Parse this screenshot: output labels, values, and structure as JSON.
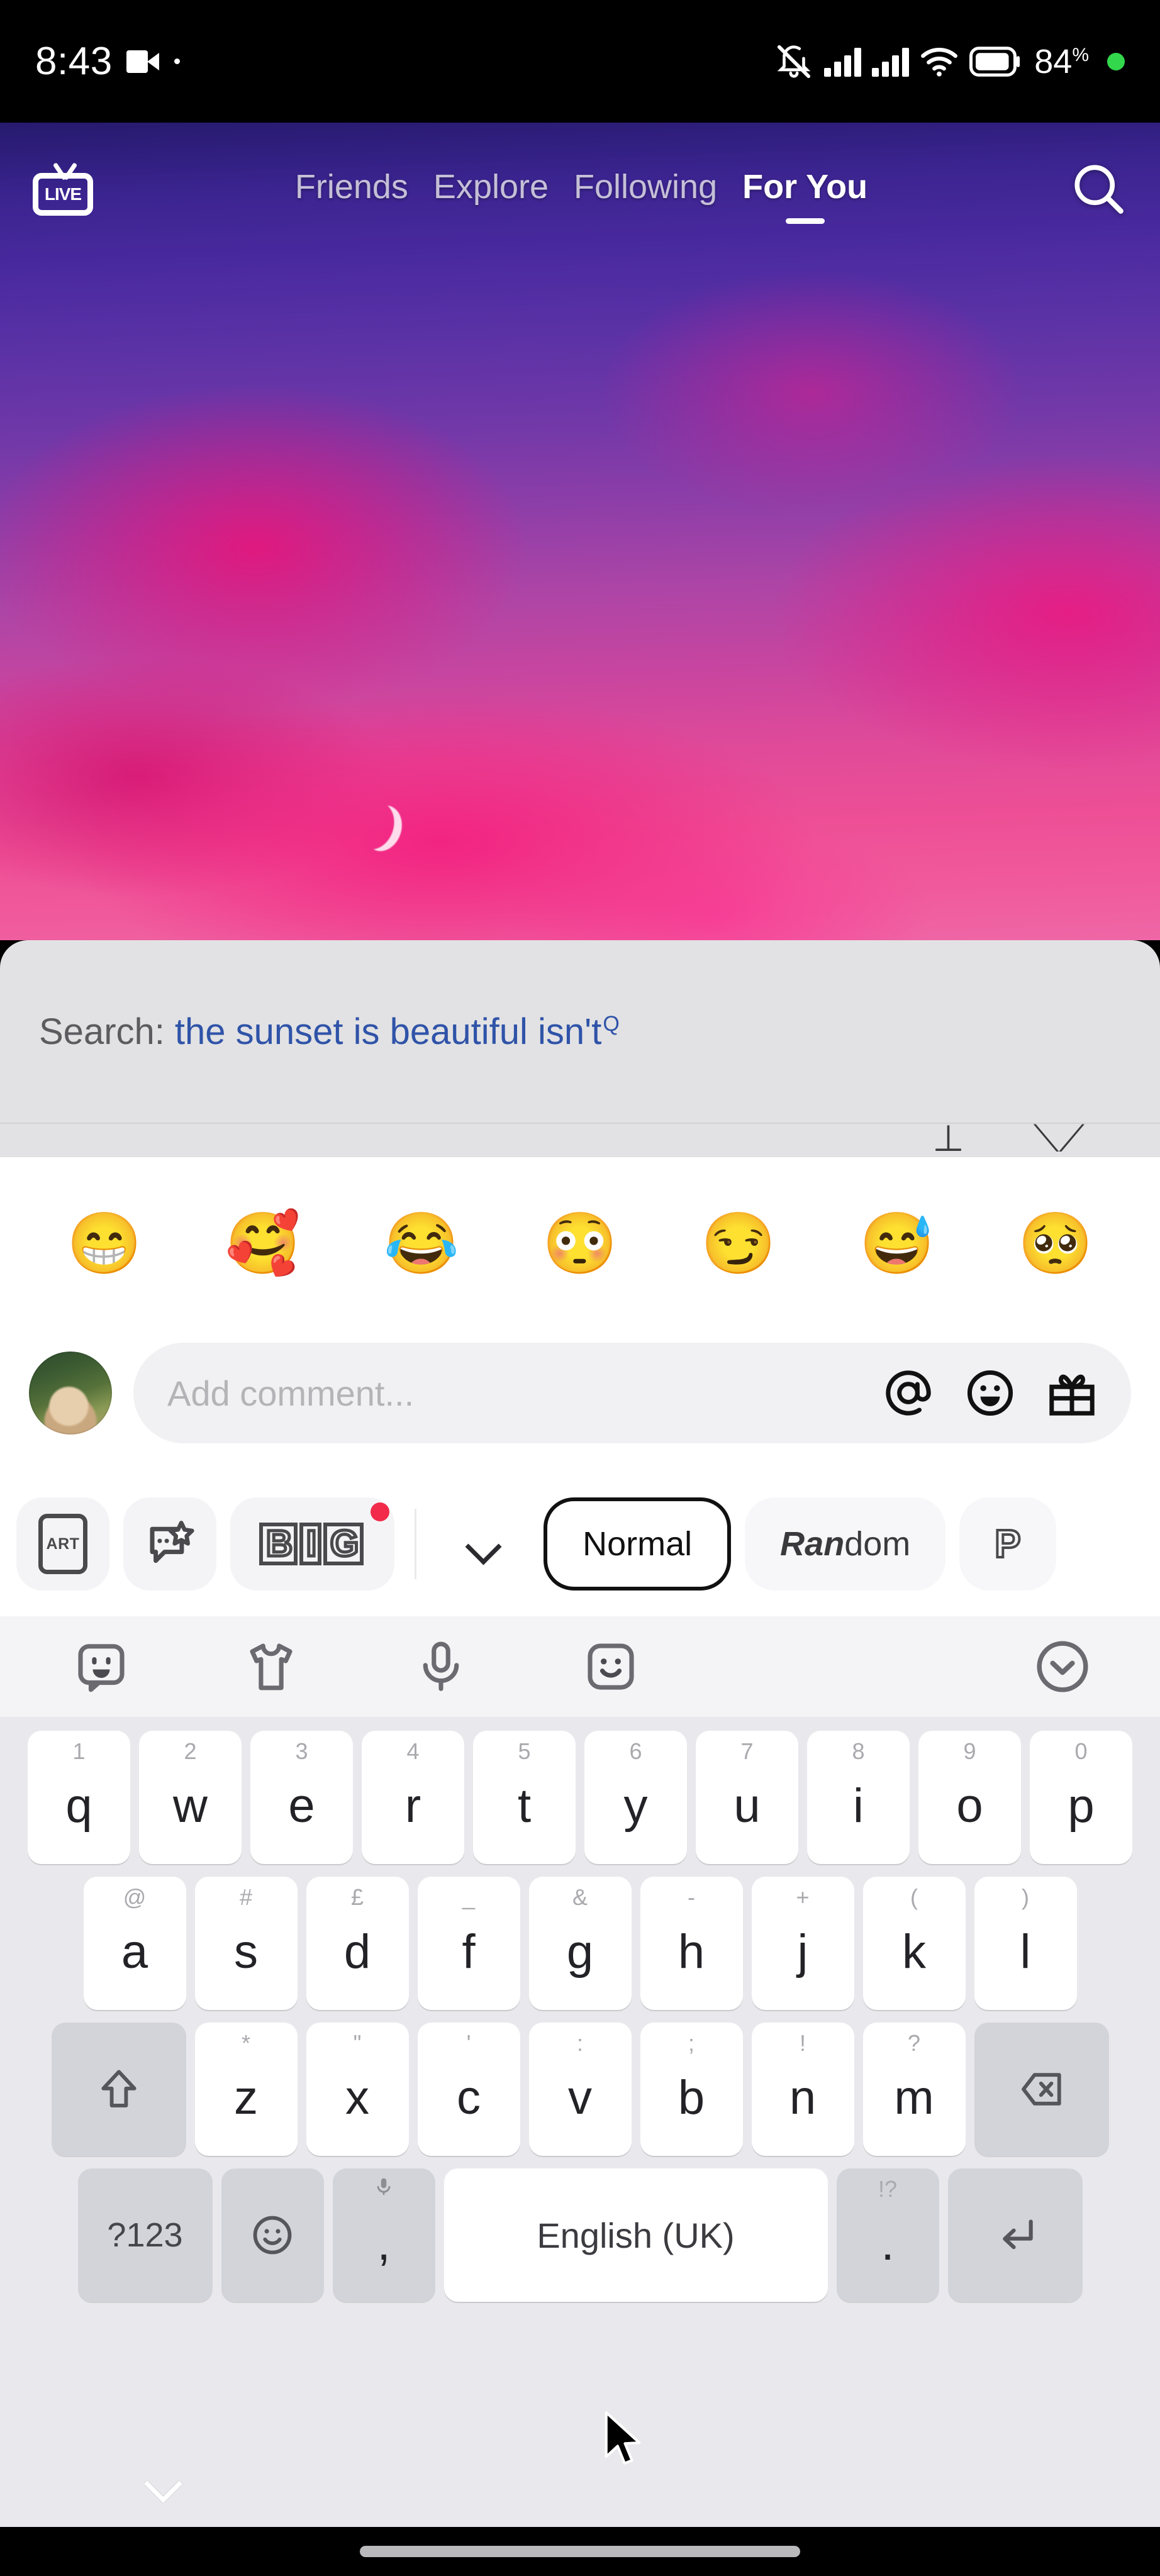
{
  "status_bar": {
    "time": "8:43",
    "video_icon": "video-camera-icon",
    "recording_dot": "·",
    "mute_icon": "bell-muted-icon",
    "signal_1": "signal-bars-icon",
    "signal_2": "signal-bars-icon",
    "wifi_icon": "wifi-icon",
    "battery_icon": "battery-icon",
    "battery_percent": "84",
    "battery_percent_symbol": "%",
    "green_dot": "recording-indicator-dot"
  },
  "top_nav": {
    "live_label": "LIVE",
    "tabs": [
      {
        "label": "Friends",
        "active": false
      },
      {
        "label": "Explore",
        "active": false
      },
      {
        "label": "Following",
        "active": false
      },
      {
        "label": "For You",
        "active": true
      }
    ],
    "search_icon": "search-icon"
  },
  "video": {
    "description": "sunset sky with pink and purple clouds and a crescent moon"
  },
  "suggestion_sheet": {
    "label": "Search:",
    "query": "the sunset is beautiful isn't",
    "query_badge": "Q",
    "second_row_partial": "⊥ᵢ  ⟍⟋"
  },
  "emoji_quick_row": {
    "emojis": [
      {
        "char": "😁",
        "name": "beaming-face-emoji"
      },
      {
        "char": "🥰",
        "name": "smiling-face-with-hearts-emoji"
      },
      {
        "char": "😂",
        "name": "face-with-tears-of-joy-emoji"
      },
      {
        "char": "😳",
        "name": "flushed-face-emoji"
      },
      {
        "char": "😏",
        "name": "smirking-face-emoji"
      },
      {
        "char": "😅",
        "name": "grinning-face-with-sweat-emoji"
      },
      {
        "char": "🥺",
        "name": "pleading-face-emoji"
      }
    ]
  },
  "comment_bar": {
    "avatar": "user-avatar",
    "placeholder": "Add comment...",
    "mention_icon": "at-mention-icon",
    "emoji_icon": "smiley-face-icon",
    "gift_icon": "gift-icon"
  },
  "style_bar": {
    "art_label": "ART",
    "sticker_icon": "sticker-star-icon",
    "big_label": "BIG",
    "big_has_badge": true,
    "badge_color": "#f22b4a",
    "chevron_icon": "chevron-down-icon",
    "options": [
      {
        "label": "Normal",
        "selected": true
      },
      {
        "label_bold": "Ran",
        "label_rest": "dom",
        "selected": false
      },
      {
        "label": "P",
        "selected": false
      }
    ]
  },
  "keyboard": {
    "toolbar_icons": [
      "emoji-sticker-icon",
      "tshirt-icon",
      "microphone-icon",
      "smiley-sticker-icon"
    ],
    "collapse_icon": "chevron-down-circle-icon",
    "row1": [
      {
        "key": "q",
        "sup": "1"
      },
      {
        "key": "w",
        "sup": "2"
      },
      {
        "key": "e",
        "sup": "3"
      },
      {
        "key": "r",
        "sup": "4"
      },
      {
        "key": "t",
        "sup": "5"
      },
      {
        "key": "y",
        "sup": "6"
      },
      {
        "key": "u",
        "sup": "7"
      },
      {
        "key": "i",
        "sup": "8"
      },
      {
        "key": "o",
        "sup": "9"
      },
      {
        "key": "p",
        "sup": "0"
      }
    ],
    "row2": [
      {
        "key": "a",
        "sup": "@"
      },
      {
        "key": "s",
        "sup": "#"
      },
      {
        "key": "d",
        "sup": "£"
      },
      {
        "key": "f",
        "sup": "_"
      },
      {
        "key": "g",
        "sup": "&"
      },
      {
        "key": "h",
        "sup": "-"
      },
      {
        "key": "j",
        "sup": "+"
      },
      {
        "key": "k",
        "sup": "("
      },
      {
        "key": "l",
        "sup": ")"
      }
    ],
    "row3": [
      {
        "key": "z",
        "sup": "*"
      },
      {
        "key": "x",
        "sup": "\""
      },
      {
        "key": "c",
        "sup": "'"
      },
      {
        "key": "v",
        "sup": ":"
      },
      {
        "key": "b",
        "sup": ";"
      },
      {
        "key": "n",
        "sup": "!"
      },
      {
        "key": "m",
        "sup": "?"
      }
    ],
    "shift_icon": "shift-arrow-icon",
    "backspace_icon": "backspace-icon",
    "symbols_label": "?123",
    "emoji_key_icon": "smiley-face-icon",
    "comma_key": ",",
    "comma_sup_icon": "microphone-icon",
    "space_label": "English (UK)",
    "period_key": ".",
    "period_sup": "!?",
    "enter_icon": "enter-return-icon",
    "hide_keyboard_icon": "chevron-down-icon"
  },
  "system_nav": {
    "gesture_pill": "home-gesture-pill"
  },
  "cursor": {
    "icon": "mouse-pointer-cursor"
  }
}
